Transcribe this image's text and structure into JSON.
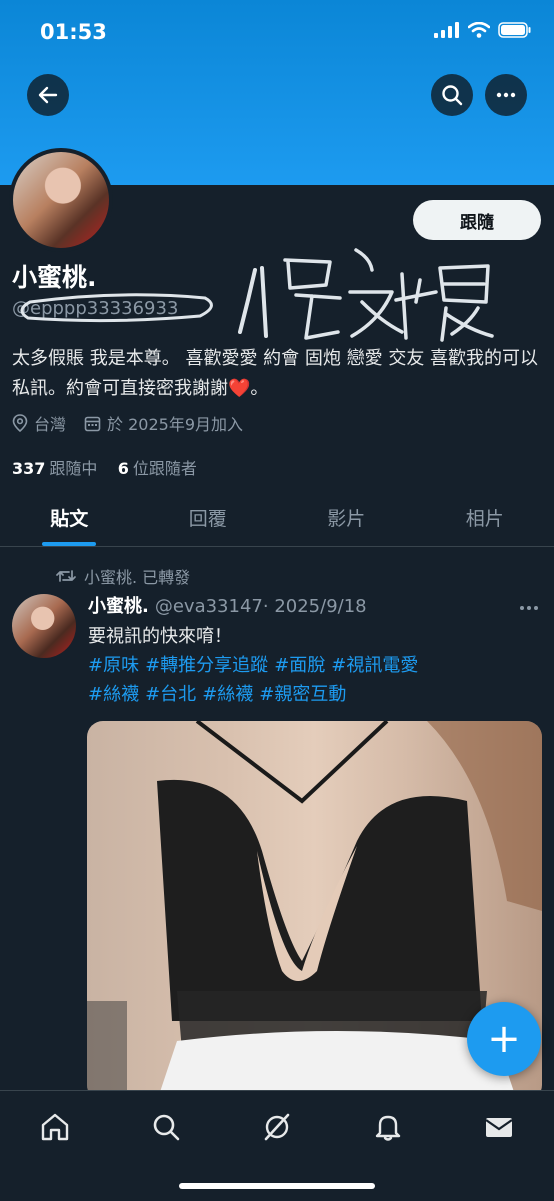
{
  "status_bar": {
    "time": "01:53"
  },
  "profile": {
    "follow_label": "跟隨",
    "name": "小蜜桃.",
    "handle": "@epppp33336933",
    "overlay_handwriting": "假帳",
    "bio": "太多假賬 我是本尊。 喜歡愛愛 約會 固炮 戀愛 交友 喜歡我的可以私訊。約會可直接密我謝謝",
    "bio_emoji": "❤️",
    "bio_end": "。",
    "location": "台灣",
    "joined": "於 2025年9月加入",
    "following_count": "337",
    "following_label": "跟隨中",
    "followers_count": "6",
    "followers_label": "位跟隨者"
  },
  "tabs": [
    {
      "label": "貼文",
      "active": true
    },
    {
      "label": "回覆",
      "active": false
    },
    {
      "label": "影片",
      "active": false
    },
    {
      "label": "相片",
      "active": false
    }
  ],
  "post": {
    "retweet_text": "小蜜桃. 已轉發",
    "author_name": "小蜜桃.",
    "author_handle": "@eva33147",
    "date": "· 2025/9/18",
    "text": "要視訊的快來唷！",
    "hashtags": [
      "#原味",
      "#轉推分享追蹤",
      "#面脫",
      "#視訊電愛",
      "#絲襪",
      "#台北",
      "#絲襪",
      "#親密互動"
    ]
  },
  "fab_label": "+",
  "colors": {
    "accent": "#1d9bf0",
    "background": "#15202b",
    "secondary_text": "#8b98a5"
  }
}
